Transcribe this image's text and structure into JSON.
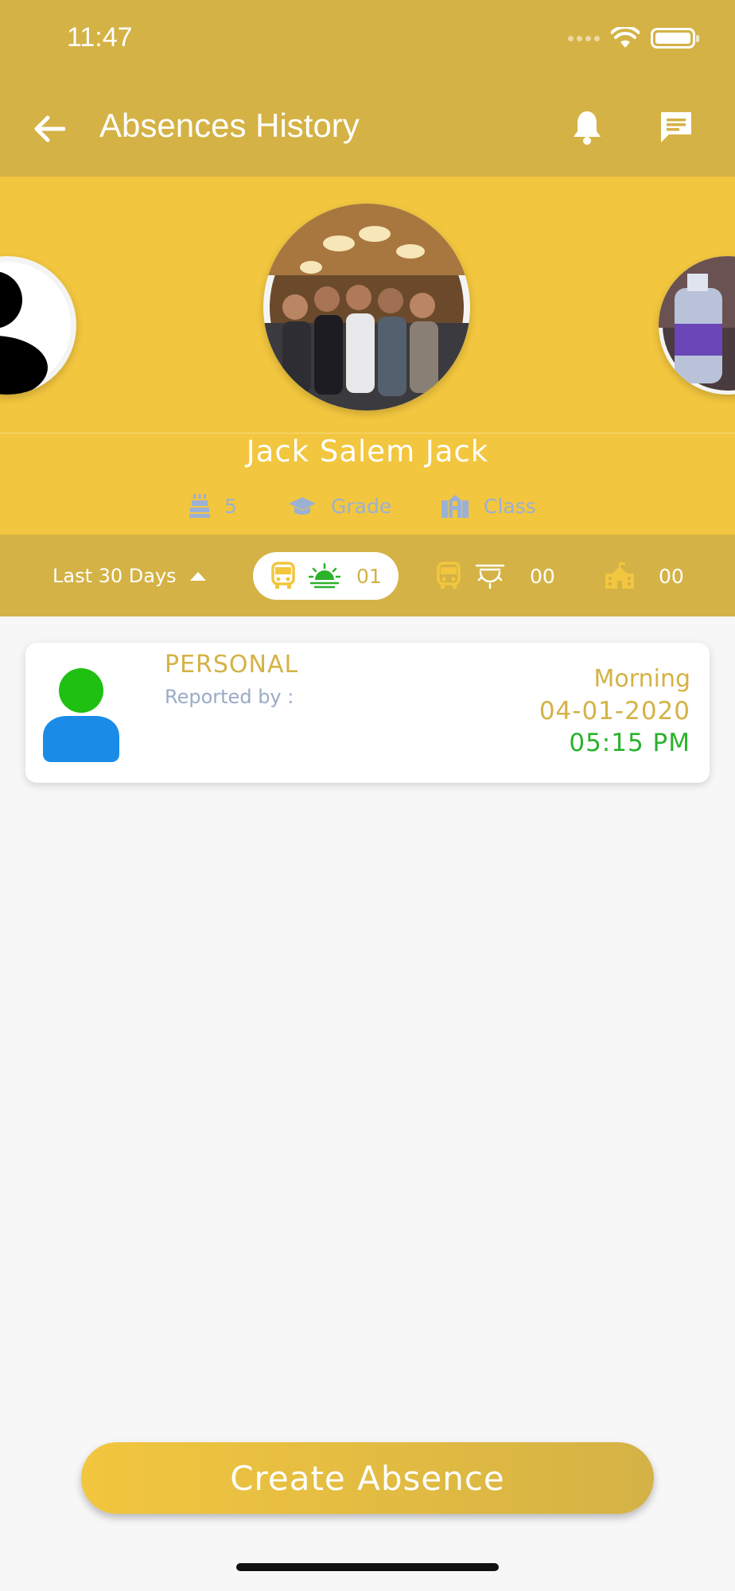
{
  "status_bar": {
    "time": "11:47"
  },
  "header": {
    "title": "Absences History",
    "icons": {
      "back": "arrow-left-icon",
      "notifications": "bell-icon",
      "messages": "chat-icon"
    }
  },
  "student": {
    "name": "Jack Salem Jack",
    "age": "5",
    "grade": "Grade",
    "class": "Class"
  },
  "filter": {
    "range_label": "Last 30 Days",
    "morning_count": "01",
    "evening_count": "00",
    "school_count": "00"
  },
  "absences": [
    {
      "reason": "PERSONAL",
      "reported_by": "Reported by :",
      "period": "Morning",
      "date": "04-01-2020",
      "time": "05:15 PM"
    }
  ],
  "actions": {
    "create_label": "Create Absence"
  },
  "colors": {
    "header": "#d4b245",
    "profile_bg": "#f2c63e",
    "accent_gold": "#d4b245",
    "time_green": "#2bb22b",
    "meta_blue": "#9cb0d4",
    "avatar_head_green": "#1fc012",
    "avatar_body_blue": "#1a8ce8"
  }
}
